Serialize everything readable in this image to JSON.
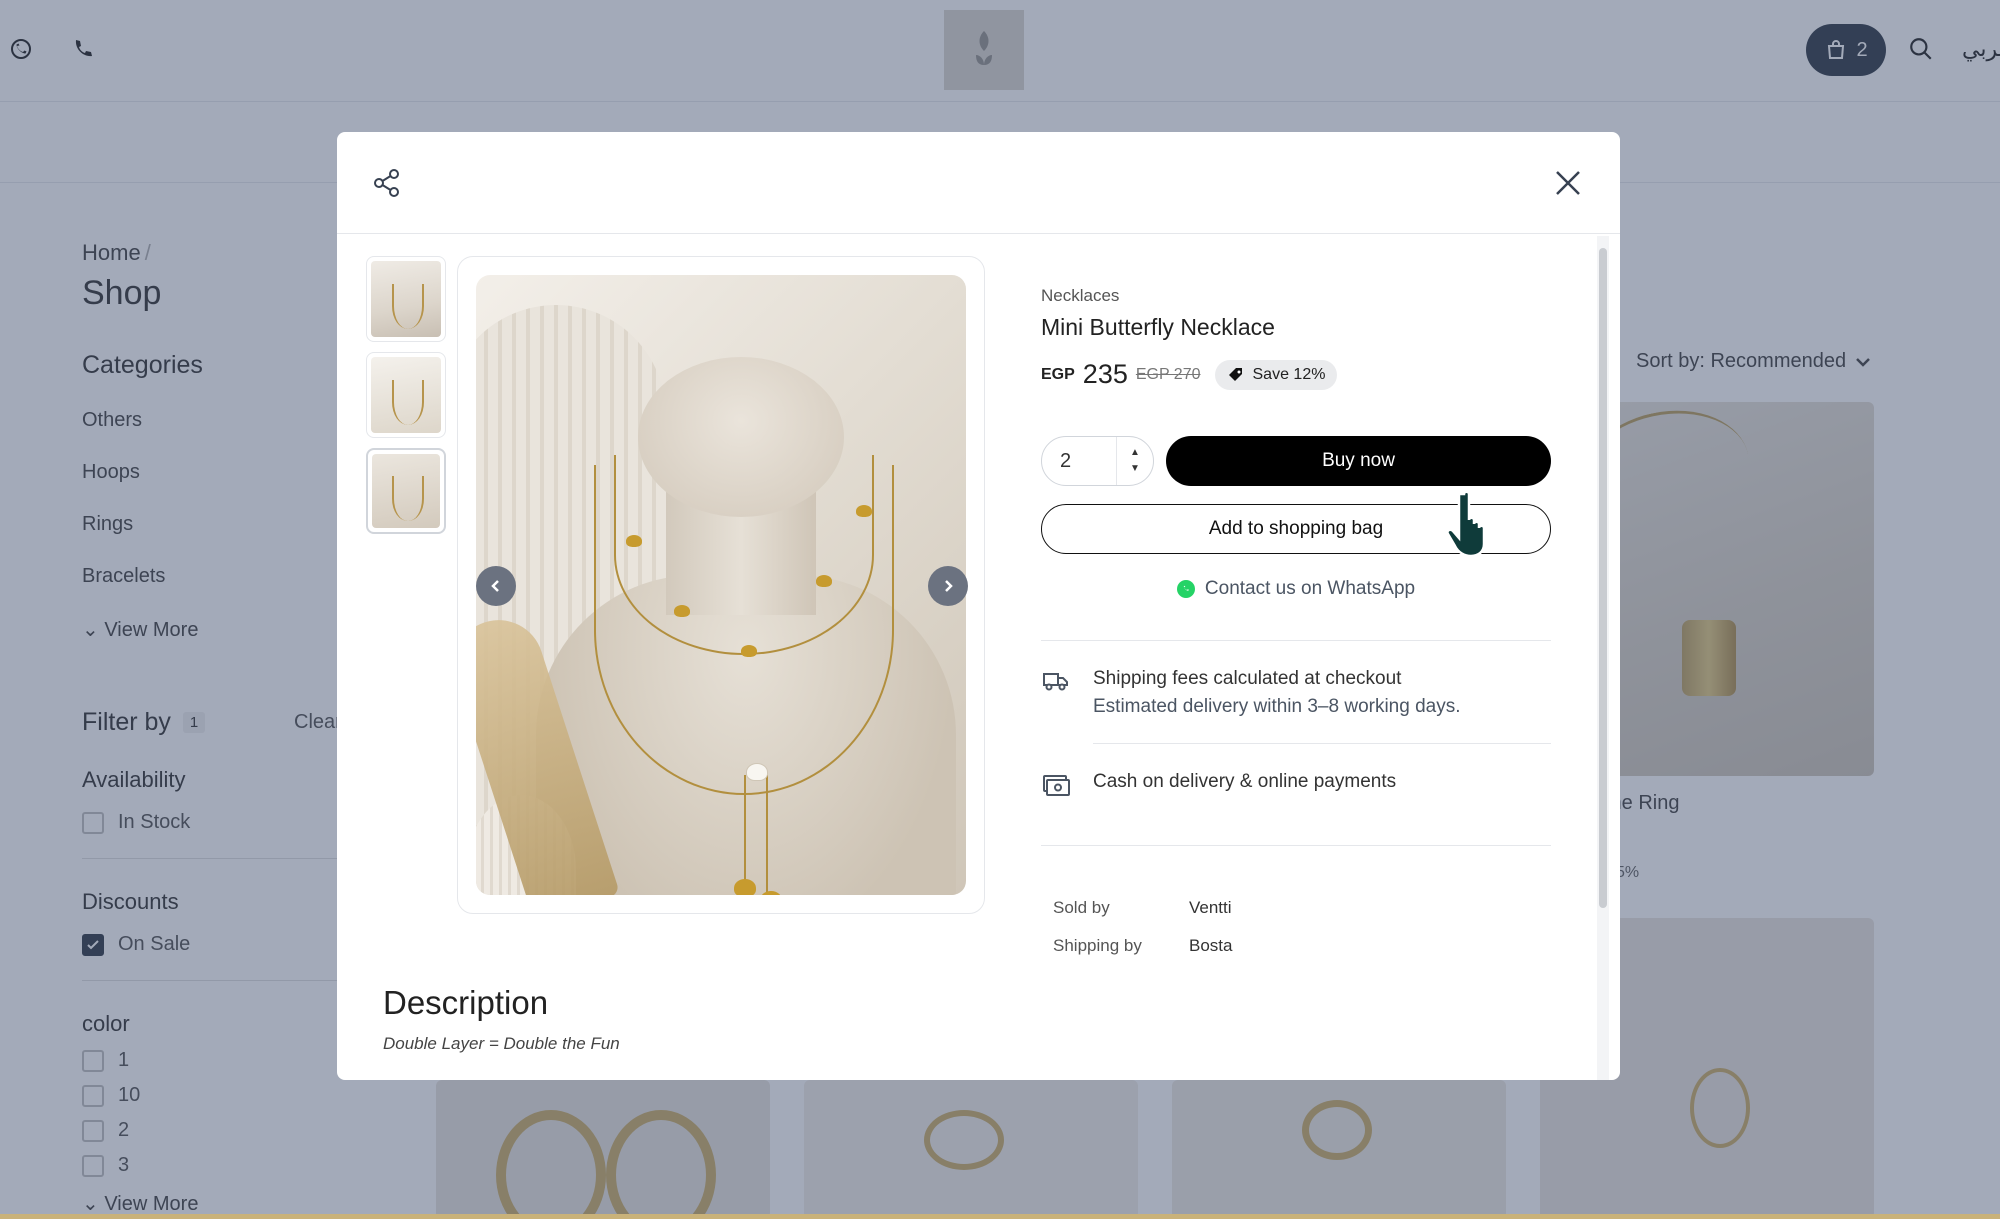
{
  "header": {
    "bag_count": "2",
    "lang_label": "عربي"
  },
  "sidebar": {
    "breadcrumb_home": "Home",
    "breadcrumb_sep": "/",
    "page_title": "Shop",
    "categories_title": "Categories",
    "categories": [
      "Others",
      "Hoops",
      "Rings",
      "Bracelets"
    ],
    "view_more": "View More",
    "filter_title": "Filter by",
    "filter_count": "1",
    "clear": "Clear",
    "availability_title": "Availability",
    "in_stock": "In Stock",
    "discounts_title": "Discounts",
    "on_sale": "On Sale",
    "color_title": "color",
    "colors": [
      "1",
      "10",
      "2",
      "3"
    ],
    "color_view_more": "View More"
  },
  "listing": {
    "sort_label": "Sort by: Recommended",
    "visible_title_fragment": "me Ring",
    "visible_discount_fragment": "5%"
  },
  "modal": {
    "category": "Necklaces",
    "product_name": "Mini Butterfly Necklace",
    "currency": "EGP",
    "price": "235",
    "old_price": "EGP 270",
    "save_label": "Save 12%",
    "quantity": "2",
    "buy_now": "Buy now",
    "add_to_bag": "Add to shopping bag",
    "whatsapp": "Contact us on WhatsApp",
    "shipping_title": "Shipping fees calculated at checkout",
    "shipping_sub": "Estimated delivery within 3–8 working days.",
    "payment": "Cash on delivery & online payments",
    "sold_by_label": "Sold by",
    "sold_by_value": "Ventti",
    "shipping_by_label": "Shipping by",
    "shipping_by_value": "Bosta",
    "description_title": "Description",
    "description_text": "Double Layer = Double the Fun"
  },
  "colors": {
    "overlay": "#475573",
    "primary_button": "#000000",
    "whatsapp_green": "#25d366",
    "bag_button": "#1f2937"
  }
}
